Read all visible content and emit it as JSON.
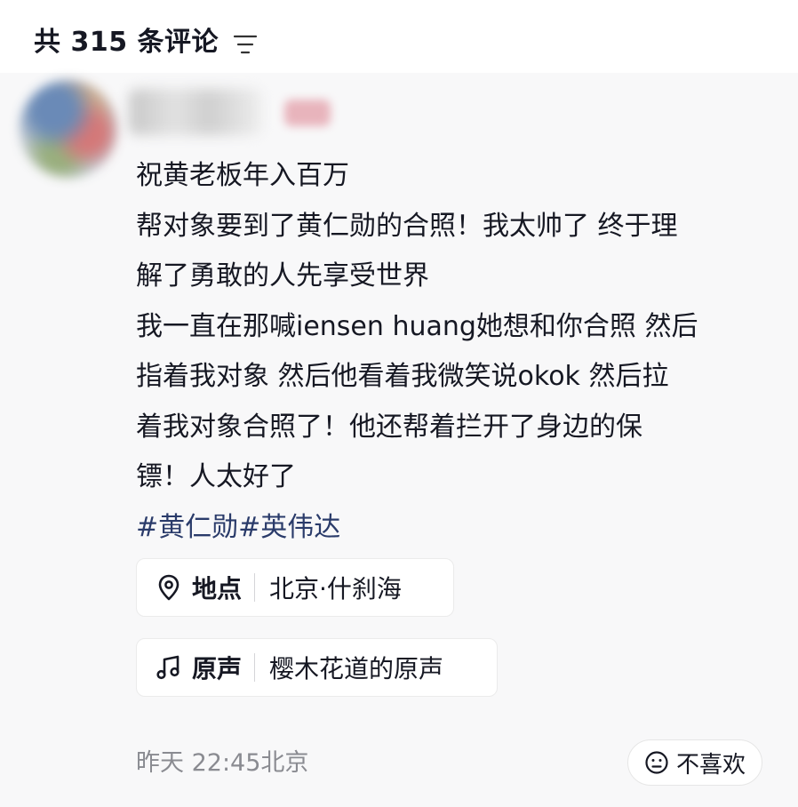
{
  "header": {
    "comment_count_title": "共 315 条评论",
    "filter_icon": "filter-lines-icon"
  },
  "comment": {
    "avatar_icon": "user-avatar-blurred",
    "body_lines": [
      "祝黄老板年入百万",
      "帮对象要到了黄仁勋的合照！我太帅了 终于理",
      "解了勇敢的人先享受世界",
      "我一直在那喊iensen huang她想和你合照 然后",
      "指着我对象 然后他看着我微笑说okok 然后拉",
      "着我对象合照了！他还帮着拦开了身边的保",
      "镖！人太好了"
    ],
    "hashtags": "#黄仁勋#英伟达",
    "location": {
      "icon": "location-pin-icon",
      "label": "地点",
      "value": "北京·什刹海"
    },
    "music": {
      "icon": "music-note-icon",
      "label": "原声",
      "value": "樱木花道的原声"
    },
    "timestamp": "昨天 22:45北京",
    "dislike": {
      "icon": "frown-face-icon",
      "label": "不喜欢"
    }
  }
}
